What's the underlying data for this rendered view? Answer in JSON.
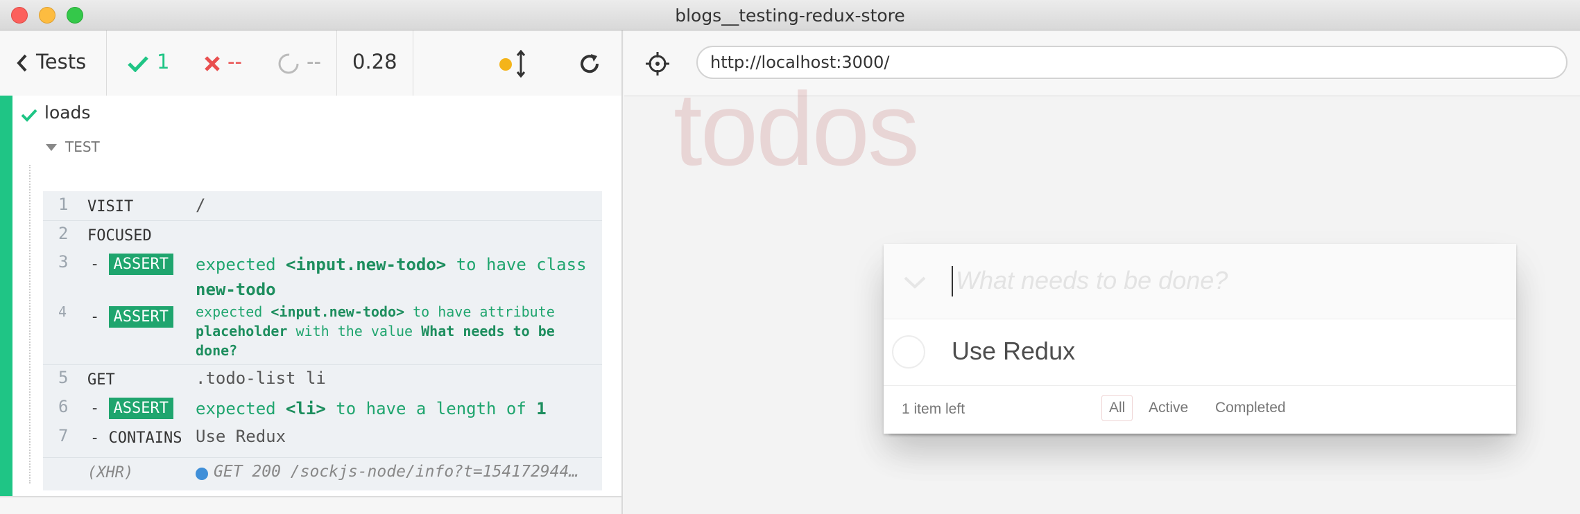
{
  "window": {
    "title": "blogs__testing-redux-store"
  },
  "reporter": {
    "header": {
      "tests_label": "Tests",
      "passed": "1",
      "failed": "--",
      "pending": "--",
      "duration": "0.28"
    },
    "test": {
      "title": "loads",
      "section": "TEST",
      "commands": [
        {
          "num": "1",
          "name": "VISIT",
          "message": "/"
        },
        {
          "num": "2",
          "name": "FOCUSED",
          "message": ""
        },
        {
          "num": "3",
          "name": "ASSERT",
          "message_parts": [
            "expected",
            "<input.new-todo>",
            "to have class",
            "new-todo"
          ]
        },
        {
          "num": "4",
          "name": "ASSERT",
          "message_parts": [
            "expected",
            "<input.new-todo>",
            "to have attribute",
            "placeholder",
            "with the value",
            "What needs to be",
            "done?"
          ]
        },
        {
          "num": "5",
          "name": "GET",
          "message": ".todo-list li"
        },
        {
          "num": "6",
          "name": "ASSERT",
          "message_parts": [
            "expected",
            "<li>",
            "to have a length of",
            "1"
          ]
        },
        {
          "num": "7",
          "name": "CONTAINS",
          "message": "Use Redux"
        },
        {
          "num": "",
          "name": "(XHR)",
          "message": "GET 200 /sockjs-node/info?t=154172944…"
        }
      ]
    }
  },
  "aut": {
    "url": "http://localhost:3000/",
    "app": {
      "title": "todos",
      "new_todo_placeholder": "What needs to be done?",
      "todos": [
        {
          "label": "Use Redux",
          "completed": false
        }
      ],
      "footer": {
        "count": "1 item left",
        "filters": [
          {
            "label": "All",
            "selected": true
          },
          {
            "label": "Active",
            "selected": false
          },
          {
            "label": "Completed",
            "selected": false
          }
        ]
      }
    }
  },
  "colors": {
    "passed": "#1fc585",
    "failed": "#e94f4f",
    "accent": "#1fa56e"
  }
}
